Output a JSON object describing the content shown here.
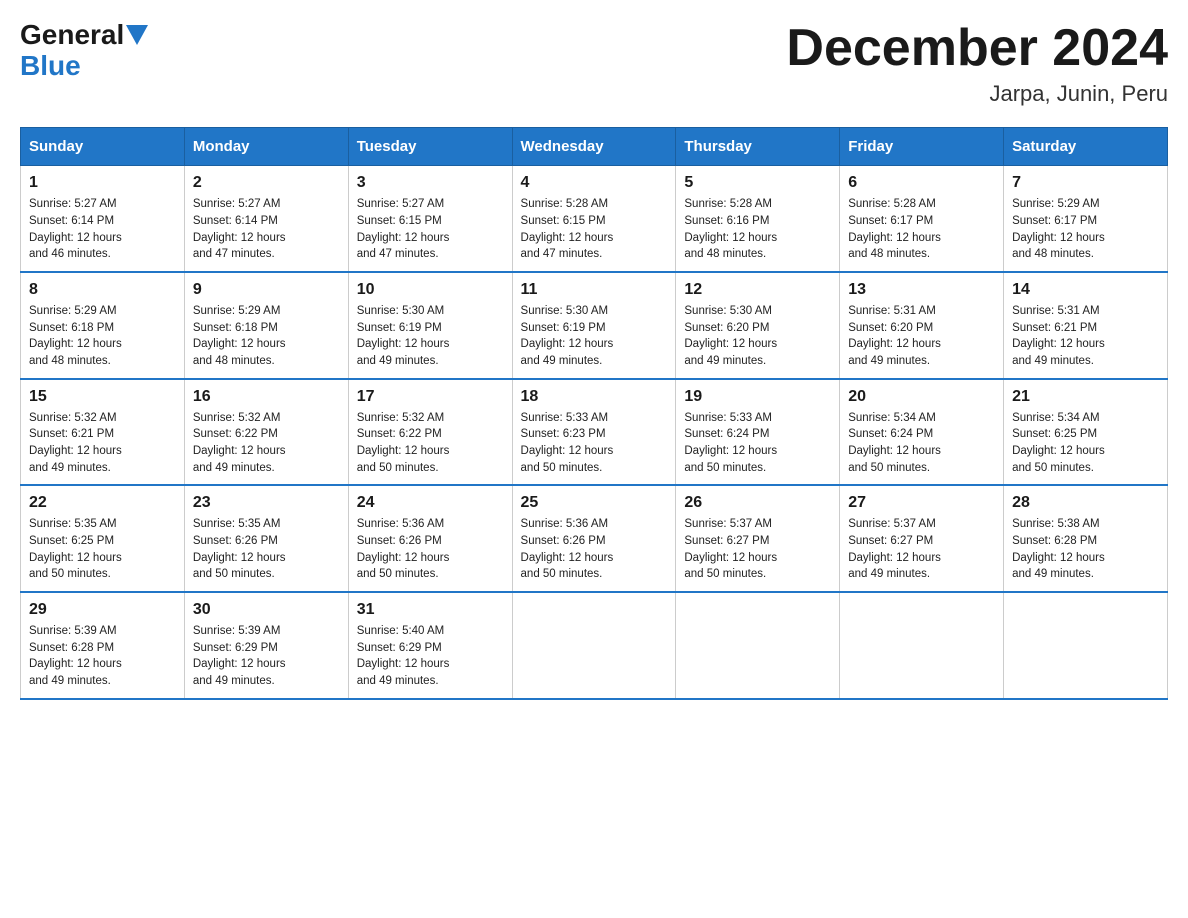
{
  "logo": {
    "general": "General",
    "blue": "Blue"
  },
  "title": {
    "month_year": "December 2024",
    "location": "Jarpa, Junin, Peru"
  },
  "header": {
    "days": [
      "Sunday",
      "Monday",
      "Tuesday",
      "Wednesday",
      "Thursday",
      "Friday",
      "Saturday"
    ]
  },
  "weeks": [
    [
      {
        "date": "1",
        "sunrise": "5:27 AM",
        "sunset": "6:14 PM",
        "daylight": "12 hours and 46 minutes."
      },
      {
        "date": "2",
        "sunrise": "5:27 AM",
        "sunset": "6:14 PM",
        "daylight": "12 hours and 47 minutes."
      },
      {
        "date": "3",
        "sunrise": "5:27 AM",
        "sunset": "6:15 PM",
        "daylight": "12 hours and 47 minutes."
      },
      {
        "date": "4",
        "sunrise": "5:28 AM",
        "sunset": "6:15 PM",
        "daylight": "12 hours and 47 minutes."
      },
      {
        "date": "5",
        "sunrise": "5:28 AM",
        "sunset": "6:16 PM",
        "daylight": "12 hours and 48 minutes."
      },
      {
        "date": "6",
        "sunrise": "5:28 AM",
        "sunset": "6:17 PM",
        "daylight": "12 hours and 48 minutes."
      },
      {
        "date": "7",
        "sunrise": "5:29 AM",
        "sunset": "6:17 PM",
        "daylight": "12 hours and 48 minutes."
      }
    ],
    [
      {
        "date": "8",
        "sunrise": "5:29 AM",
        "sunset": "6:18 PM",
        "daylight": "12 hours and 48 minutes."
      },
      {
        "date": "9",
        "sunrise": "5:29 AM",
        "sunset": "6:18 PM",
        "daylight": "12 hours and 48 minutes."
      },
      {
        "date": "10",
        "sunrise": "5:30 AM",
        "sunset": "6:19 PM",
        "daylight": "12 hours and 49 minutes."
      },
      {
        "date": "11",
        "sunrise": "5:30 AM",
        "sunset": "6:19 PM",
        "daylight": "12 hours and 49 minutes."
      },
      {
        "date": "12",
        "sunrise": "5:30 AM",
        "sunset": "6:20 PM",
        "daylight": "12 hours and 49 minutes."
      },
      {
        "date": "13",
        "sunrise": "5:31 AM",
        "sunset": "6:20 PM",
        "daylight": "12 hours and 49 minutes."
      },
      {
        "date": "14",
        "sunrise": "5:31 AM",
        "sunset": "6:21 PM",
        "daylight": "12 hours and 49 minutes."
      }
    ],
    [
      {
        "date": "15",
        "sunrise": "5:32 AM",
        "sunset": "6:21 PM",
        "daylight": "12 hours and 49 minutes."
      },
      {
        "date": "16",
        "sunrise": "5:32 AM",
        "sunset": "6:22 PM",
        "daylight": "12 hours and 49 minutes."
      },
      {
        "date": "17",
        "sunrise": "5:32 AM",
        "sunset": "6:22 PM",
        "daylight": "12 hours and 50 minutes."
      },
      {
        "date": "18",
        "sunrise": "5:33 AM",
        "sunset": "6:23 PM",
        "daylight": "12 hours and 50 minutes."
      },
      {
        "date": "19",
        "sunrise": "5:33 AM",
        "sunset": "6:24 PM",
        "daylight": "12 hours and 50 minutes."
      },
      {
        "date": "20",
        "sunrise": "5:34 AM",
        "sunset": "6:24 PM",
        "daylight": "12 hours and 50 minutes."
      },
      {
        "date": "21",
        "sunrise": "5:34 AM",
        "sunset": "6:25 PM",
        "daylight": "12 hours and 50 minutes."
      }
    ],
    [
      {
        "date": "22",
        "sunrise": "5:35 AM",
        "sunset": "6:25 PM",
        "daylight": "12 hours and 50 minutes."
      },
      {
        "date": "23",
        "sunrise": "5:35 AM",
        "sunset": "6:26 PM",
        "daylight": "12 hours and 50 minutes."
      },
      {
        "date": "24",
        "sunrise": "5:36 AM",
        "sunset": "6:26 PM",
        "daylight": "12 hours and 50 minutes."
      },
      {
        "date": "25",
        "sunrise": "5:36 AM",
        "sunset": "6:26 PM",
        "daylight": "12 hours and 50 minutes."
      },
      {
        "date": "26",
        "sunrise": "5:37 AM",
        "sunset": "6:27 PM",
        "daylight": "12 hours and 50 minutes."
      },
      {
        "date": "27",
        "sunrise": "5:37 AM",
        "sunset": "6:27 PM",
        "daylight": "12 hours and 49 minutes."
      },
      {
        "date": "28",
        "sunrise": "5:38 AM",
        "sunset": "6:28 PM",
        "daylight": "12 hours and 49 minutes."
      }
    ],
    [
      {
        "date": "29",
        "sunrise": "5:39 AM",
        "sunset": "6:28 PM",
        "daylight": "12 hours and 49 minutes."
      },
      {
        "date": "30",
        "sunrise": "5:39 AM",
        "sunset": "6:29 PM",
        "daylight": "12 hours and 49 minutes."
      },
      {
        "date": "31",
        "sunrise": "5:40 AM",
        "sunset": "6:29 PM",
        "daylight": "12 hours and 49 minutes."
      },
      null,
      null,
      null,
      null
    ]
  ],
  "labels": {
    "sunrise": "Sunrise:",
    "sunset": "Sunset:",
    "daylight": "Daylight:"
  }
}
